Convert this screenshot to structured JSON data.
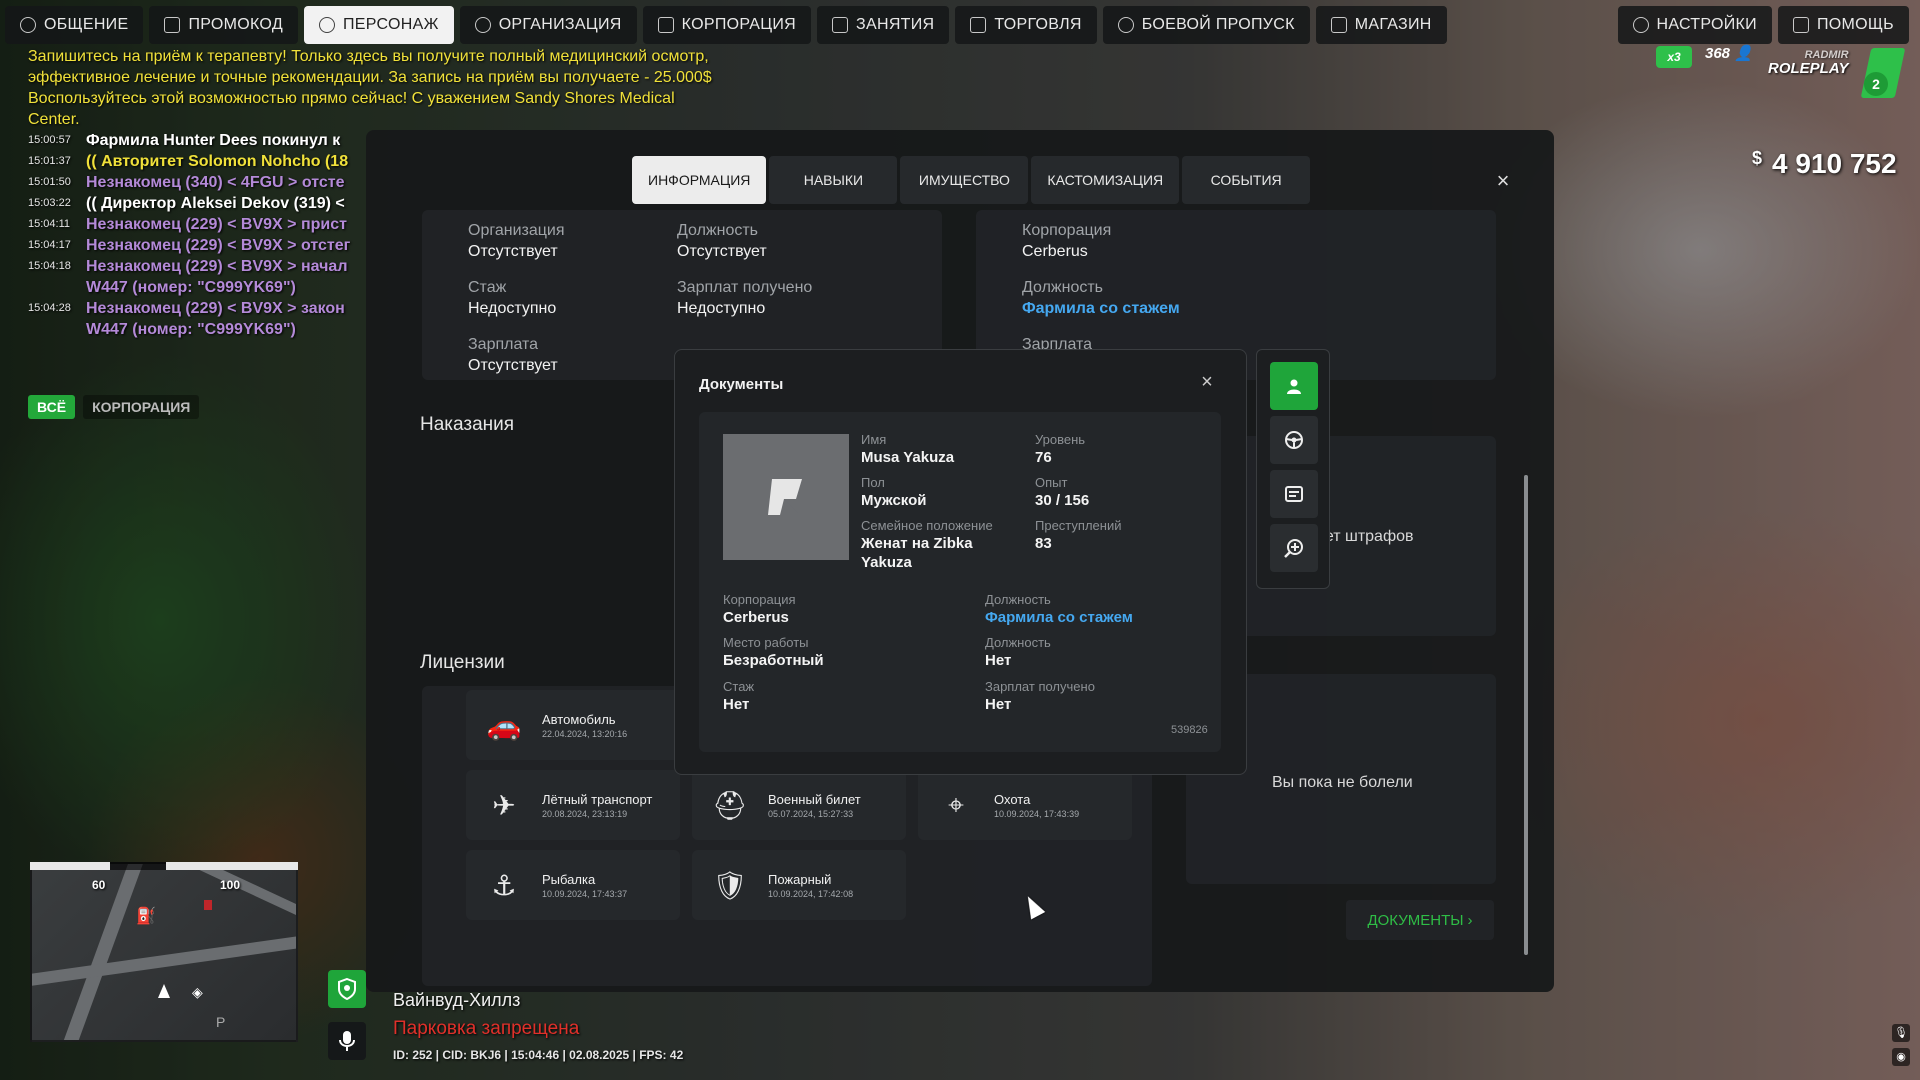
{
  "nav": {
    "left": [
      {
        "label": "ОБЩЕНИЕ",
        "icon": "chat-icon"
      },
      {
        "label": "ПРОМОКОД",
        "icon": "promo-icon"
      },
      {
        "label": "ПЕРСОНАЖ",
        "icon": "user-icon",
        "active": true
      },
      {
        "label": "ОРГАНИЗАЦИЯ",
        "icon": "organization-icon"
      },
      {
        "label": "КОРПОРАЦИЯ",
        "icon": "corporation-icon"
      },
      {
        "label": "ЗАНЯТИЯ",
        "icon": "activities-icon"
      },
      {
        "label": "ТОРГОВЛЯ",
        "icon": "trade-icon"
      },
      {
        "label": "БОЕВОЙ ПРОПУСК",
        "icon": "battlepass-icon"
      },
      {
        "label": "МАГАЗИН",
        "icon": "cart-icon"
      }
    ],
    "right": [
      {
        "label": "НАСТРОЙКИ",
        "icon": "gear-icon"
      },
      {
        "label": "ПОМОЩЬ",
        "icon": "help-icon"
      }
    ]
  },
  "chat": {
    "notice": "Запишитесь на приём к терапевту! Только здесь вы получите полный медицинский осмотр, эффективное лечение и точные рекомендации. За запись на приём вы получаете - 25.000$ Воспользуйтесь этой возможностью прямо сейчас! С уважением Sandy Shores Medical Center.",
    "lines": [
      {
        "time": "15:00:57",
        "text": "Фармила Hunter Dees покинул к",
        "color": "#ffffff"
      },
      {
        "time": "15:01:37",
        "text": "(( Авторитет Solomon Nohcho (18",
        "color": "#f0e13a"
      },
      {
        "time": "15:01:50",
        "text": "Незнакомец (340) < 4FGU > отсте",
        "color": "#b48ad8"
      },
      {
        "time": "15:03:22",
        "text": "(( Директор Aleksei Dekov (319) <",
        "color": "#ffffff"
      },
      {
        "time": "15:04:11",
        "text": "Незнакомец (229) < BV9X > прист",
        "color": "#b48ad8"
      },
      {
        "time": "15:04:17",
        "text": "Незнакомец (229) < BV9X > отстег",
        "color": "#b48ad8"
      },
      {
        "time": "15:04:18",
        "text": "Незнакомец (229) < BV9X > начал",
        "color": "#b48ad8"
      },
      {
        "time": "",
        "text": "W447 (номер: \"C999YK69\")",
        "color": "#b48ad8"
      },
      {
        "time": "15:04:28",
        "text": "Незнакомец (229) < BV9X > закон",
        "color": "#b48ad8"
      },
      {
        "time": "",
        "text": "W447 (номер: \"C999YK69\")",
        "color": "#b48ad8"
      }
    ],
    "tabs": [
      "ВСЁ",
      "КОРПОРАЦИЯ"
    ]
  },
  "hud": {
    "money_symbol": "$",
    "money": "4 910 752",
    "online": "368",
    "multiplier": "x3",
    "logo_line1": "RADMIR",
    "logo_line2": "ROLEPLAY",
    "level": "2"
  },
  "modal": {
    "tabs": [
      "ИНФОРМАЦИЯ",
      "НАВЫКИ",
      "ИМУЩЕСТВО",
      "КАСТОМИЗАЦИЯ",
      "СОБЫТИЯ"
    ],
    "close": "×",
    "org": {
      "organization_label": "Организация",
      "organization_value": "Отсутствует",
      "position_label": "Должность",
      "position_value": "Отсутствует",
      "tenure_label": "Стаж",
      "tenure_value": "Недоступно",
      "salaries_label": "Зарплат получено",
      "salaries_value": "Недоступно",
      "salary_label": "Зарплата",
      "salary_value": "Отсутствует"
    },
    "corp": {
      "corporation_label": "Корпорация",
      "corporation_value": "Cerberus",
      "position_label": "Должность",
      "position_value": "Фармила со стажем",
      "salary_label": "Зарплата"
    },
    "punishments_title": "Наказания",
    "fines_text": "нет штрафов",
    "licenses_title": "Лицензии",
    "illness_text": "Вы пока не болели",
    "licenses": [
      {
        "name": "Автомобиль",
        "date": "22.04.2024, 13:20:16",
        "icon": "car-icon"
      },
      {
        "name": "Лётный транспорт",
        "date": "20.08.2024, 23:13:19",
        "icon": "plane-icon"
      },
      {
        "name": "Военный билет",
        "date": "05.07.2024, 15:27:33",
        "icon": "military-helmet-icon"
      },
      {
        "name": "Охота",
        "date": "10.09.2024, 17:43:39",
        "icon": "crosshair-icon"
      },
      {
        "name": "Рыбалка",
        "date": "10.09.2024, 17:43:37",
        "icon": "fishing-icon"
      },
      {
        "name": "Пожарный",
        "date": "10.09.2024, 17:42:08",
        "icon": "fire-badge-icon"
      }
    ],
    "documents_button": "ДОКУМЕНТЫ"
  },
  "documents": {
    "title": "Документы",
    "name_label": "Имя",
    "name_value": "Musa Yakuza",
    "level_label": "Уровень",
    "level_value": "76",
    "gender_label": "Пол",
    "gender_value": "Мужской",
    "exp_label": "Опыт",
    "exp_value": "30 / 156",
    "marital_label": "Семейное положение",
    "marital_value": "Женат на Zibka Yakuza",
    "crimes_label": "Преступлений",
    "crimes_value": "83",
    "corporation_label": "Корпорация",
    "corporation_value": "Cerberus",
    "corp_position_label": "Должность",
    "corp_position_value": "Фармила со стажем",
    "workplace_label": "Место работы",
    "workplace_value": "Безработный",
    "position_label": "Должность",
    "position_value": "Нет",
    "tenure_label": "Стаж",
    "tenure_value": "Нет",
    "salaries_label": "Зарплат получено",
    "salaries_value": "Нет",
    "doc_id": "539826",
    "side_buttons": [
      "passport-icon",
      "steering-wheel-icon",
      "license-card-icon",
      "medical-search-icon"
    ]
  },
  "bottom": {
    "minimap_left": "60",
    "minimap_right": "100",
    "location": "Вайнвуд-Хиллз",
    "warning": "Парковка запрещена",
    "status": "ID: 252 | CID: BKJ6 | 15:04:46  | 02.08.2025 | FPS: 42"
  },
  "colors": {
    "accent_green": "#1fa53a",
    "accent_blue": "#45a8f0",
    "warning_red": "#e0302a"
  }
}
